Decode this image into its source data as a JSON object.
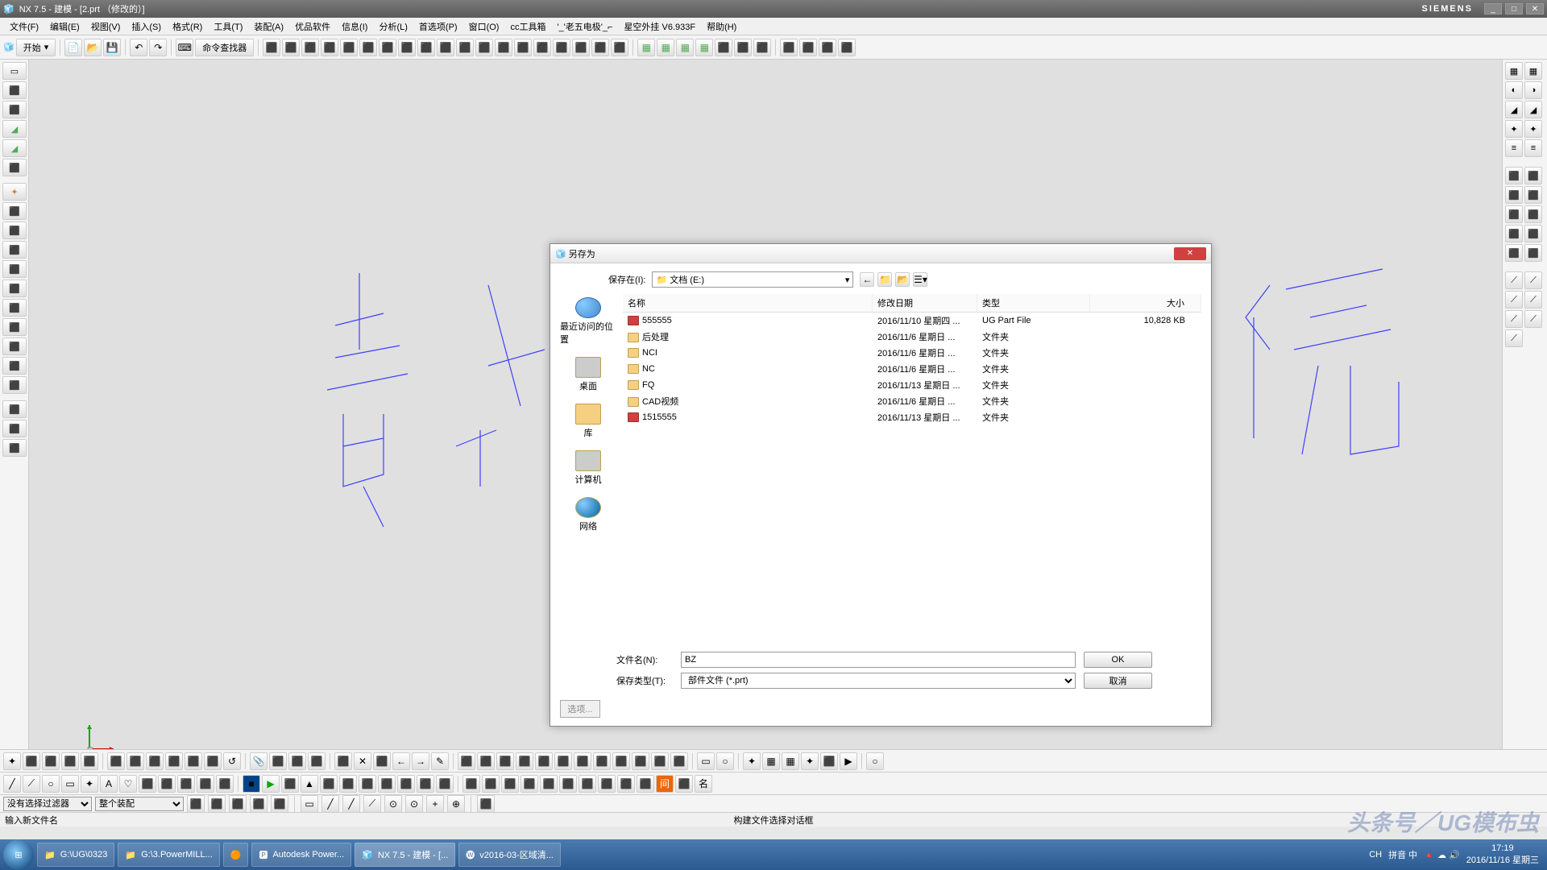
{
  "title": "NX 7.5 - 建模 - [2.prt （修改的）]",
  "brand": "SIEMENS",
  "menu": [
    "文件(F)",
    "编辑(E)",
    "视图(V)",
    "插入(S)",
    "格式(R)",
    "工具(T)",
    "装配(A)",
    "优品软件",
    "信息(I)",
    "分析(L)",
    "首选项(P)",
    "窗口(O)",
    "cc工具箱",
    "'_'老五电极'_⌐",
    "星空外挂  V6.933F",
    "帮助(H)"
  ],
  "start": "开始",
  "cmdfinder": "命令查找器",
  "dialog": {
    "title": "另存为",
    "savein_label": "保存在(I):",
    "savein_value": "文档 (E:)",
    "cols": [
      "名称",
      "修改日期",
      "类型",
      "大小"
    ],
    "places": [
      "最近访问的位置",
      "桌面",
      "库",
      "计算机",
      "网络"
    ],
    "files": [
      {
        "ico": "ug",
        "name": "555555",
        "date": "2016/11/10 星期四 ...",
        "type": "UG Part File",
        "size": "10,828 KB"
      },
      {
        "ico": "f",
        "name": "后处理",
        "date": "2016/11/6 星期日 ...",
        "type": "文件夹",
        "size": ""
      },
      {
        "ico": "f",
        "name": "NCI",
        "date": "2016/11/6 星期日 ...",
        "type": "文件夹",
        "size": ""
      },
      {
        "ico": "f",
        "name": "NC",
        "date": "2016/11/6 星期日 ...",
        "type": "文件夹",
        "size": ""
      },
      {
        "ico": "f",
        "name": "FQ",
        "date": "2016/11/13 星期日 ...",
        "type": "文件夹",
        "size": ""
      },
      {
        "ico": "f",
        "name": "CAD视频",
        "date": "2016/11/6 星期日 ...",
        "type": "文件夹",
        "size": ""
      },
      {
        "ico": "ug",
        "name": "1515555",
        "date": "2016/11/13 星期日 ...",
        "type": "文件夹",
        "size": ""
      }
    ],
    "filename_label": "文件名(N):",
    "filename_value": "BZ",
    "filetype_label": "保存类型(T):",
    "filetype_value": "部件文件 (*.prt)",
    "ok": "OK",
    "cancel": "取消",
    "options": "选项..."
  },
  "filter": {
    "a": "没有选择过滤器",
    "b": "整个装配"
  },
  "status": {
    "left": "输入新文件名",
    "center": "构建文件选择对话框"
  },
  "taskbar": {
    "items": [
      "G:\\UG\\0323",
      "G:\\3.PowerMILL...",
      "",
      "Autodesk Power...",
      "NX 7.5 - 建模 - [...",
      "v2016-03-区域清..."
    ],
    "active_index": 4,
    "ime": "CH",
    "ime2": "拼音 中",
    "time": "17:19",
    "date": "2016/11/16 星期三"
  },
  "watermark": "头条号／UG模布虫"
}
